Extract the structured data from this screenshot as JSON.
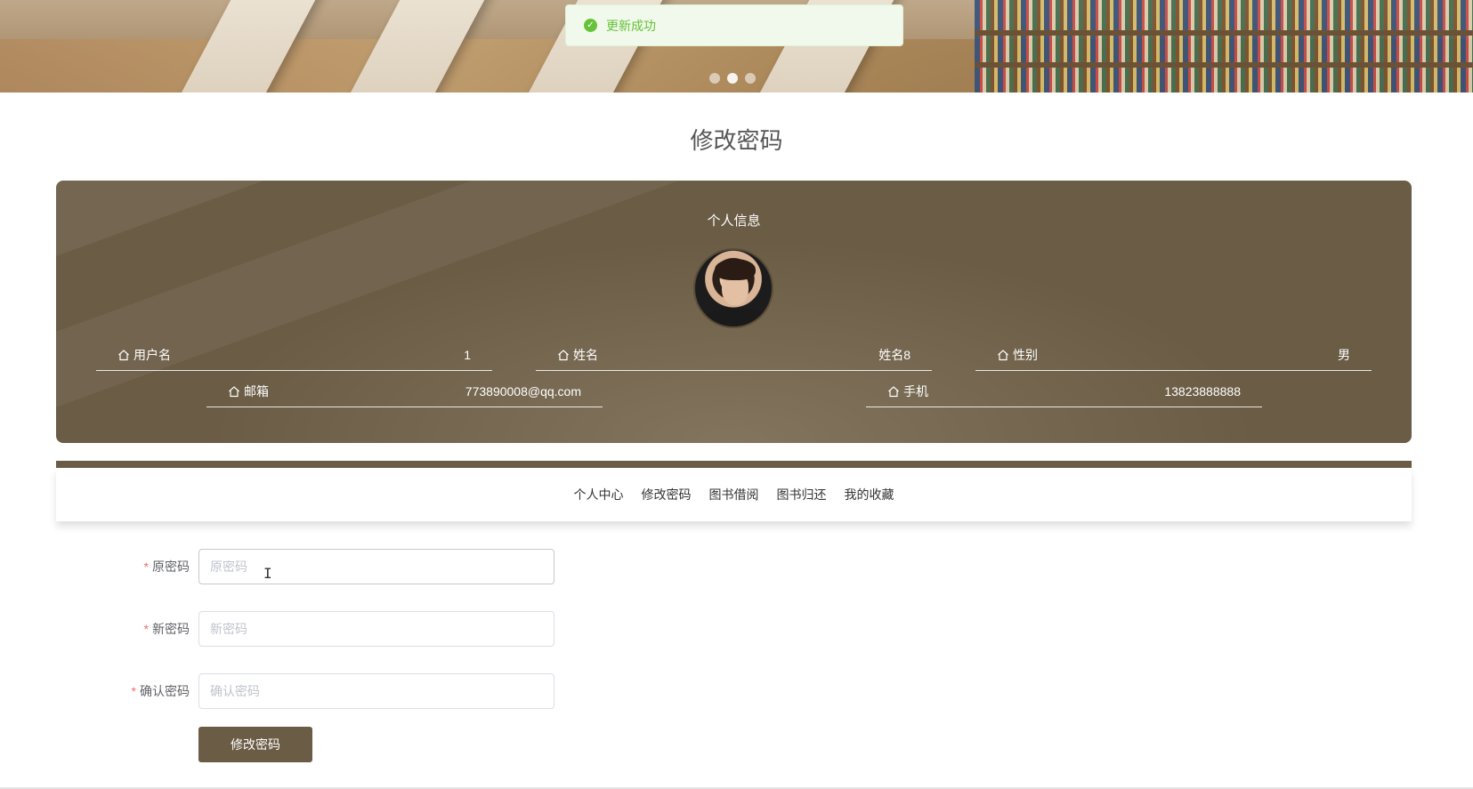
{
  "toast": {
    "message": "更新成功",
    "icon": "check-circle-icon",
    "color": "#67c23a"
  },
  "banner": {
    "slide_count": 3,
    "active_slide": 2
  },
  "page": {
    "title": "修改密码"
  },
  "profile": {
    "title": "个人信息",
    "fields": {
      "username": {
        "label": "用户名",
        "value": "1"
      },
      "name": {
        "label": "姓名",
        "value": "姓名8"
      },
      "gender": {
        "label": "性别",
        "value": "男"
      },
      "email": {
        "label": "邮箱",
        "value": "773890008@qq.com"
      },
      "phone": {
        "label": "手机",
        "value": "13823888888"
      }
    },
    "accent_color": "#6b5c45"
  },
  "tabs": {
    "items": [
      {
        "label": "个人中心"
      },
      {
        "label": "修改密码"
      },
      {
        "label": "图书借阅"
      },
      {
        "label": "图书归还"
      },
      {
        "label": "我的收藏"
      }
    ]
  },
  "form": {
    "old_password": {
      "label": "原密码",
      "placeholder": "原密码",
      "value": ""
    },
    "new_password": {
      "label": "新密码",
      "placeholder": "新密码",
      "value": ""
    },
    "confirm_password": {
      "label": "确认密码",
      "placeholder": "确认密码",
      "value": ""
    },
    "required_mark": "*",
    "submit_label": "修改密码"
  }
}
